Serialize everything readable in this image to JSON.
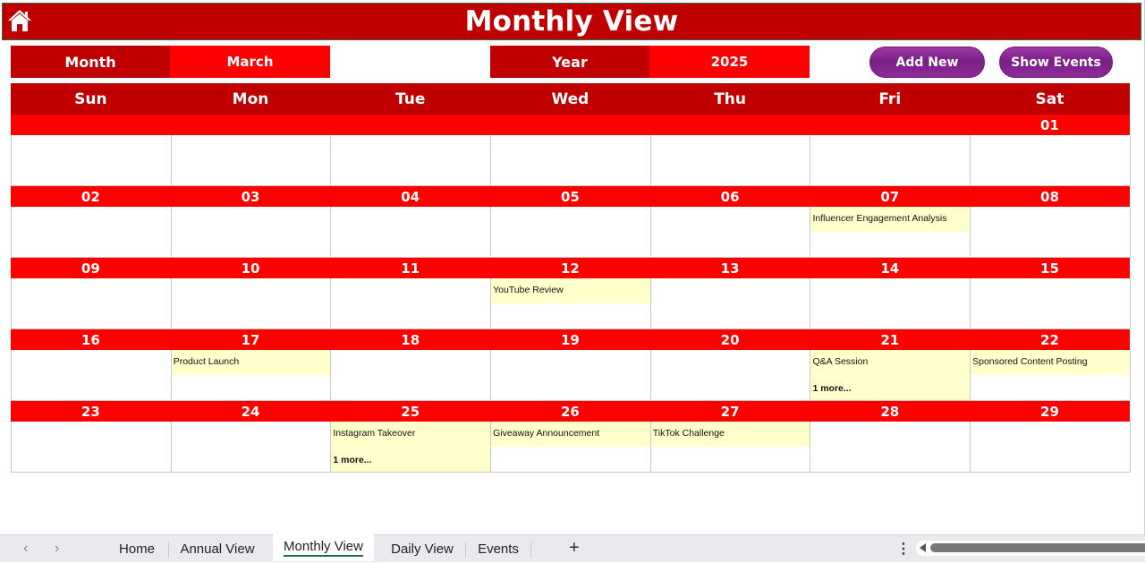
{
  "title": "Monthly View",
  "selectors": {
    "month_label": "Month",
    "month_value": "March",
    "year_label": "Year",
    "year_value": "2025"
  },
  "buttons": {
    "add_new": "Add New",
    "show_events": "Show Events"
  },
  "colors": {
    "header_dark_red": "#c00000",
    "header_red": "#ff0000",
    "event_bg": "#ffffcc",
    "button_purple": "#7a1f86"
  },
  "days_of_week": [
    "Sun",
    "Mon",
    "Tue",
    "Wed",
    "Thu",
    "Fri",
    "Sat"
  ],
  "weeks": [
    {
      "days": [
        {
          "num": "",
          "events": [],
          "more": ""
        },
        {
          "num": "",
          "events": [],
          "more": ""
        },
        {
          "num": "",
          "events": [],
          "more": ""
        },
        {
          "num": "",
          "events": [],
          "more": ""
        },
        {
          "num": "",
          "events": [],
          "more": ""
        },
        {
          "num": "",
          "events": [],
          "more": ""
        },
        {
          "num": "01",
          "events": [],
          "more": ""
        }
      ]
    },
    {
      "days": [
        {
          "num": "02",
          "events": [],
          "more": ""
        },
        {
          "num": "03",
          "events": [],
          "more": ""
        },
        {
          "num": "04",
          "events": [],
          "more": ""
        },
        {
          "num": "05",
          "events": [],
          "more": ""
        },
        {
          "num": "06",
          "events": [],
          "more": ""
        },
        {
          "num": "07",
          "events": [
            "Influencer Engagement Analysis"
          ],
          "more": ""
        },
        {
          "num": "08",
          "events": [],
          "more": ""
        }
      ]
    },
    {
      "days": [
        {
          "num": "09",
          "events": [],
          "more": ""
        },
        {
          "num": "10",
          "events": [],
          "more": ""
        },
        {
          "num": "11",
          "events": [],
          "more": ""
        },
        {
          "num": "12",
          "events": [
            "YouTube Review"
          ],
          "more": ""
        },
        {
          "num": "13",
          "events": [],
          "more": ""
        },
        {
          "num": "14",
          "events": [],
          "more": ""
        },
        {
          "num": "15",
          "events": [],
          "more": ""
        }
      ]
    },
    {
      "days": [
        {
          "num": "16",
          "events": [],
          "more": ""
        },
        {
          "num": "17",
          "events": [
            "Product Launch"
          ],
          "more": ""
        },
        {
          "num": "18",
          "events": [],
          "more": ""
        },
        {
          "num": "19",
          "events": [],
          "more": ""
        },
        {
          "num": "20",
          "events": [],
          "more": ""
        },
        {
          "num": "21",
          "events": [
            "Q&A Session"
          ],
          "more": "1 more..."
        },
        {
          "num": "22",
          "events": [
            "Sponsored Content Posting"
          ],
          "more": ""
        }
      ]
    },
    {
      "days": [
        {
          "num": "23",
          "events": [],
          "more": ""
        },
        {
          "num": "24",
          "events": [],
          "more": ""
        },
        {
          "num": "25",
          "events": [
            "Instagram Takeover"
          ],
          "more": "1 more..."
        },
        {
          "num": "26",
          "events": [
            "Giveaway Announcement"
          ],
          "more": ""
        },
        {
          "num": "27",
          "events": [
            "TikTok Challenge"
          ],
          "more": ""
        },
        {
          "num": "28",
          "events": [],
          "more": ""
        },
        {
          "num": "29",
          "events": [],
          "more": ""
        }
      ]
    }
  ],
  "sheet_tabs": [
    "Home",
    "Annual View",
    "Monthly View",
    "Daily View",
    "Events"
  ],
  "active_tab": "Monthly View",
  "icons": {
    "home": "home-icon",
    "prev": "chevron-left-icon",
    "next": "chevron-right-icon",
    "add_sheet": "plus-icon",
    "more": "kebab-icon"
  }
}
